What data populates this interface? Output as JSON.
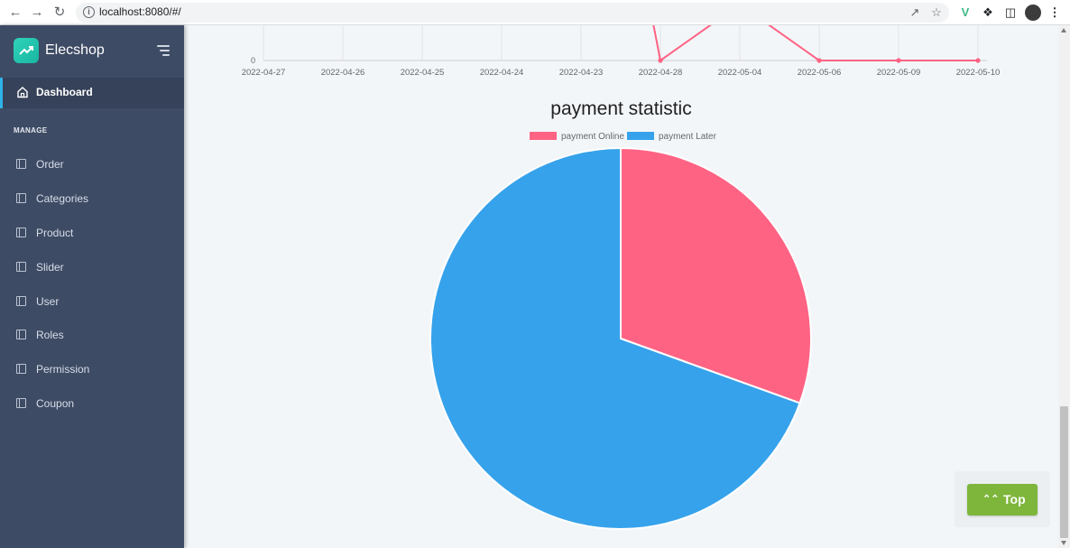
{
  "browser": {
    "url": "localhost:8080/#/",
    "back_icon": "arrow-left-icon",
    "forward_icon": "arrow-right-icon",
    "reload_icon": "reload-icon"
  },
  "sidebar": {
    "brand": "Elecshop",
    "dashboard_label": "Dashboard",
    "section_title": "MANAGE",
    "items": [
      {
        "label": "Order"
      },
      {
        "label": "Categories"
      },
      {
        "label": "Product"
      },
      {
        "label": "Slider"
      },
      {
        "label": "User"
      },
      {
        "label": "Roles"
      },
      {
        "label": "Permission"
      },
      {
        "label": "Coupon"
      }
    ]
  },
  "colors": {
    "sidebar_bg": "#3e4b64",
    "accent": "#2fb4e9",
    "online": "#ff6384",
    "later": "#36a2eb",
    "top_button": "#7eb63b"
  },
  "chart_data": [
    {
      "type": "line",
      "title": "",
      "categories": [
        "2022-04-27",
        "2022-04-26",
        "2022-04-25",
        "2022-04-24",
        "2022-04-23",
        "2022-04-28",
        "2022-05-04",
        "2022-05-06",
        "2022-05-09",
        "2022-05-10"
      ],
      "y_tick_labels": [
        "0"
      ],
      "series": [
        {
          "color": "#ff6384",
          "visible_points": {
            "2022-04-28": 0,
            "2022-05-06": 0,
            "2022-05-09": 0,
            "2022-05-10": 0
          }
        }
      ],
      "grid": true
    },
    {
      "type": "pie",
      "title": "payment statistic",
      "legend": "top",
      "labels": [
        "payment Online",
        "payment Later"
      ],
      "values": [
        30.5,
        69.5
      ],
      "colors": [
        "#ff6384",
        "#36a2eb"
      ]
    }
  ],
  "top_button": {
    "label": "Top",
    "icon": "double-chevron-up-icon"
  }
}
